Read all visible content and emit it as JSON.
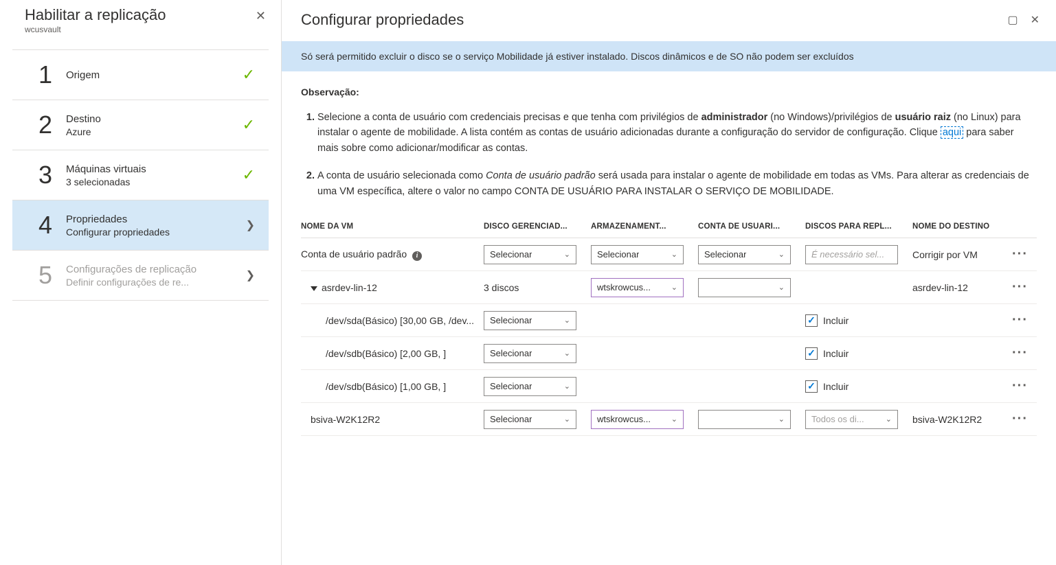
{
  "left": {
    "title": "Habilitar a replicação",
    "subtitle": "wcusvault",
    "steps": [
      {
        "num": "1",
        "label": "Origem",
        "sub": "",
        "status": "done"
      },
      {
        "num": "2",
        "label": "Destino",
        "sub": "Azure",
        "status": "done"
      },
      {
        "num": "3",
        "label": "Máquinas virtuais",
        "sub": "3 selecionadas",
        "status": "done"
      },
      {
        "num": "4",
        "label": "Propriedades",
        "sub": "Configurar propriedades",
        "status": "active"
      },
      {
        "num": "5",
        "label": "Configurações de replicação",
        "sub": "Definir configurações de re...",
        "status": "disabled"
      }
    ]
  },
  "right": {
    "title": "Configurar propriedades",
    "info_bar": "Só será permitido excluir o disco se o serviço Mobilidade já estiver instalado. Discos dinâmicos e de SO não podem ser excluídos",
    "obs_title": "Observação:",
    "obs1_a": "Selecione a conta de usuário com credenciais precisas e que tenha com privilégios de ",
    "obs1_b": "administrador",
    "obs1_c": " (no Windows)/privilégios de ",
    "obs1_d": "usuário raiz",
    "obs1_e": " (no Linux) para instalar o agente de mobilidade. A lista contém as contas de usuário adicionadas durante a configuração do servidor de configuração. Clique ",
    "obs1_link": "aqui",
    "obs1_f": " para saber mais sobre como adicionar/modificar as contas.",
    "obs2_a": "A conta de usuário selecionada como ",
    "obs2_b": "Conta de usuário padrão",
    "obs2_c": " será usada para instalar o agente de mobilidade em todas as VMs. Para alterar as credenciais de uma VM específica, altere o valor no campo CONTA DE USUÁRIO PARA INSTALAR O SERVIÇO DE MOBILIDADE.",
    "headers": {
      "vm": "NOME DA VM",
      "disk": "DISCO GERENCIAD...",
      "storage": "ARMAZENAMENT...",
      "account": "CONTA DE USUÁRI...",
      "repl": "DISCOS PARA REPL...",
      "dest": "NOME DO DESTINO"
    },
    "labels": {
      "selecionar": "Selecionar",
      "incluir": "Incluir",
      "necessario": "É necessário sel...",
      "todos": "Todos os di...",
      "wtsk": "wtskrowcus...",
      "corrigir": "Corrigir por VM",
      "tres_discos": "3 discos"
    },
    "rows": {
      "default_account": "Conta de usuário padrão",
      "vm1_name": "asrdev-lin-12",
      "vm1_dest": "asrdev-lin-12",
      "vm1_disk1": "/dev/sda(Básico) [30,00 GB, /dev...",
      "vm1_disk2": "/dev/sdb(Básico) [2,00 GB, ]",
      "vm1_disk3": "/dev/sdb(Básico) [1,00 GB, ]",
      "vm2_name": "bsiva-W2K12R2",
      "vm2_dest": "bsiva-W2K12R2"
    }
  }
}
